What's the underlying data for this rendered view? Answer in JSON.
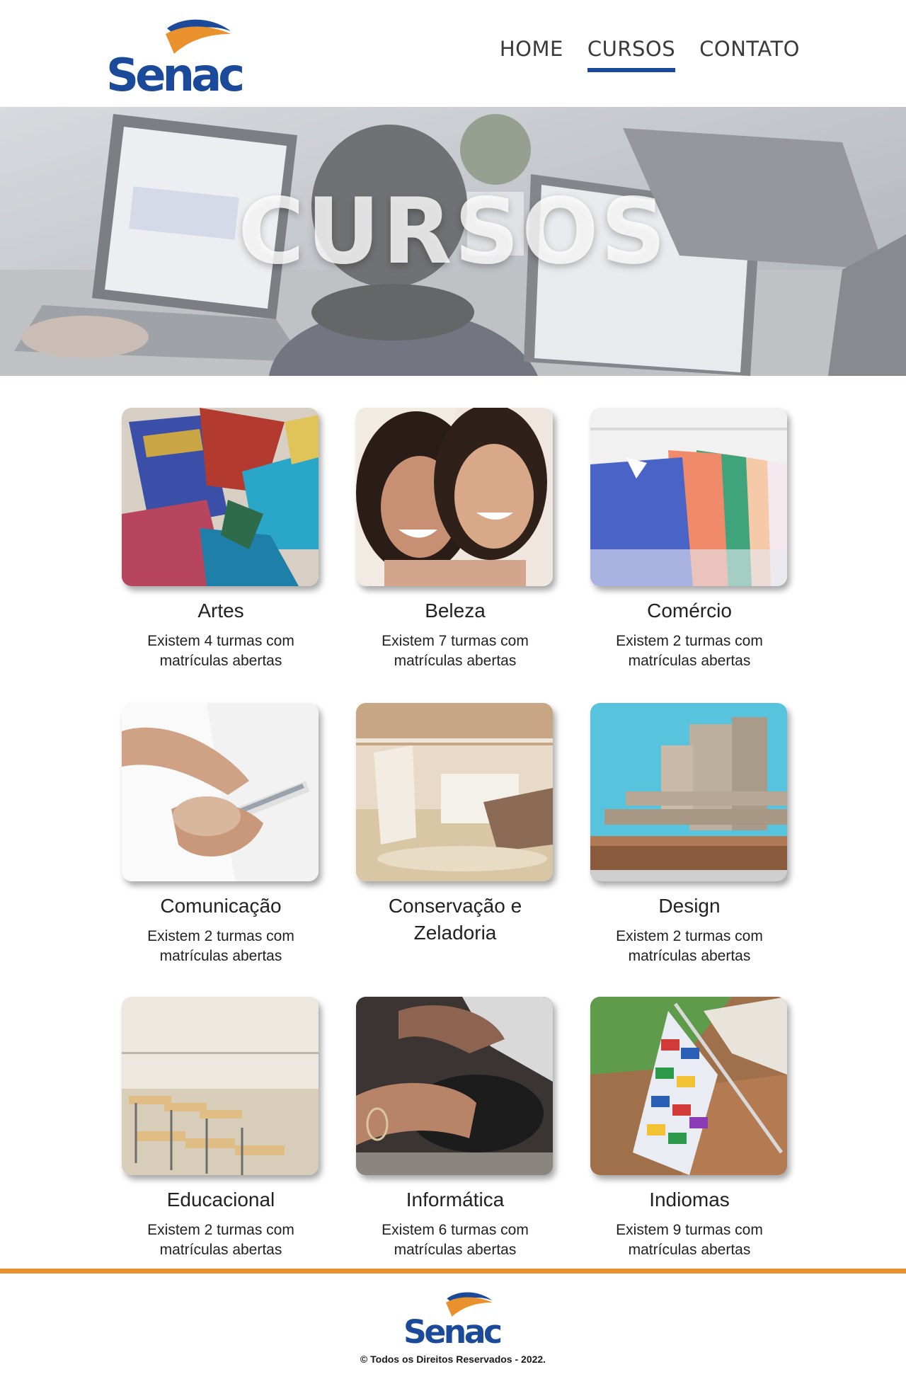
{
  "brand": {
    "logo_text": "Senac",
    "primary_color": "#1b4a9a",
    "accent_color": "#e9912c"
  },
  "nav": {
    "items": [
      {
        "label": "HOME",
        "active": false
      },
      {
        "label": "CURSOS",
        "active": true
      },
      {
        "label": "CONTATO",
        "active": false
      }
    ]
  },
  "hero": {
    "title": "CURSOS"
  },
  "courses": [
    {
      "title": "Artes",
      "description": "Existem 4 turmas com matrículas abertas"
    },
    {
      "title": "Beleza",
      "description": "Existem 7 turmas com matrículas abertas"
    },
    {
      "title": "Comércio",
      "description": "Existem 2 turmas com matrículas abertas"
    },
    {
      "title": "Comunicação",
      "description": "Existem 2 turmas com matrículas abertas"
    },
    {
      "title": "Conservação e Zeladoria",
      "description": ""
    },
    {
      "title": "Design",
      "description": "Existem 2 turmas com matrículas abertas"
    },
    {
      "title": "Educacional",
      "description": "Existem 2 turmas com matrículas abertas"
    },
    {
      "title": "Informática",
      "description": "Existem 6 turmas com matrículas abertas"
    },
    {
      "title": "Indiomas",
      "description": "Existem 9 turmas com matrículas abertas"
    }
  ],
  "footer": {
    "copyright": "© Todos os Direitos Reservados - 2022."
  }
}
